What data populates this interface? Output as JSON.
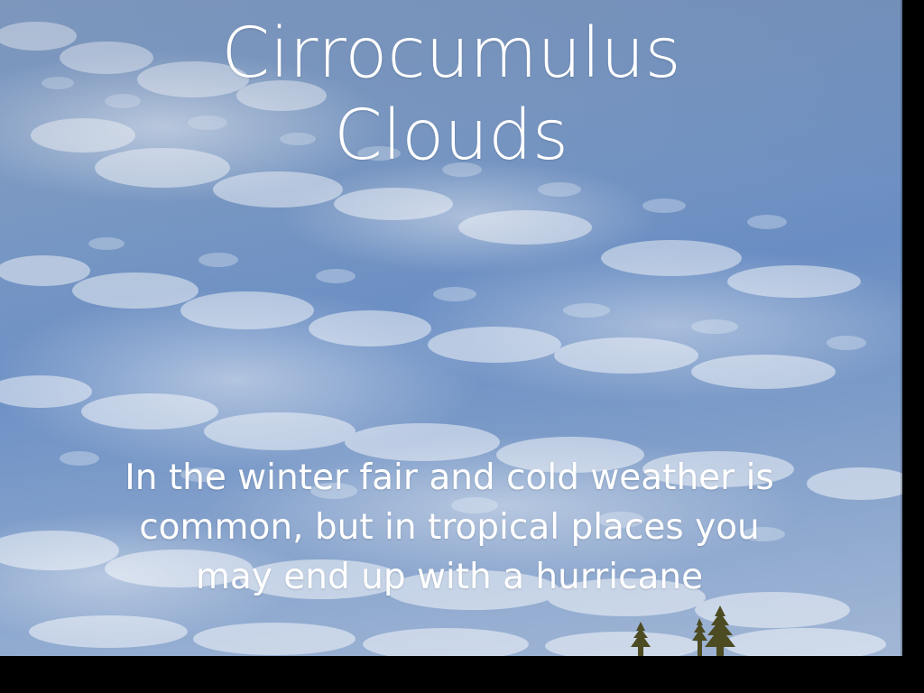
{
  "slide": {
    "title": "Cirrocumulus\nClouds",
    "caption": "In the winter fair and cold weather is\ncommon, but in tropical places you\nmay end up with a hurricane"
  },
  "colors": {
    "background": "#000000",
    "sky": "#7f9dc6",
    "cloud": "#ffffff",
    "text": "#ffffff",
    "tree": "#4d4b22"
  },
  "icons": {
    "tree_left": "tree",
    "tree_right": "tree"
  }
}
